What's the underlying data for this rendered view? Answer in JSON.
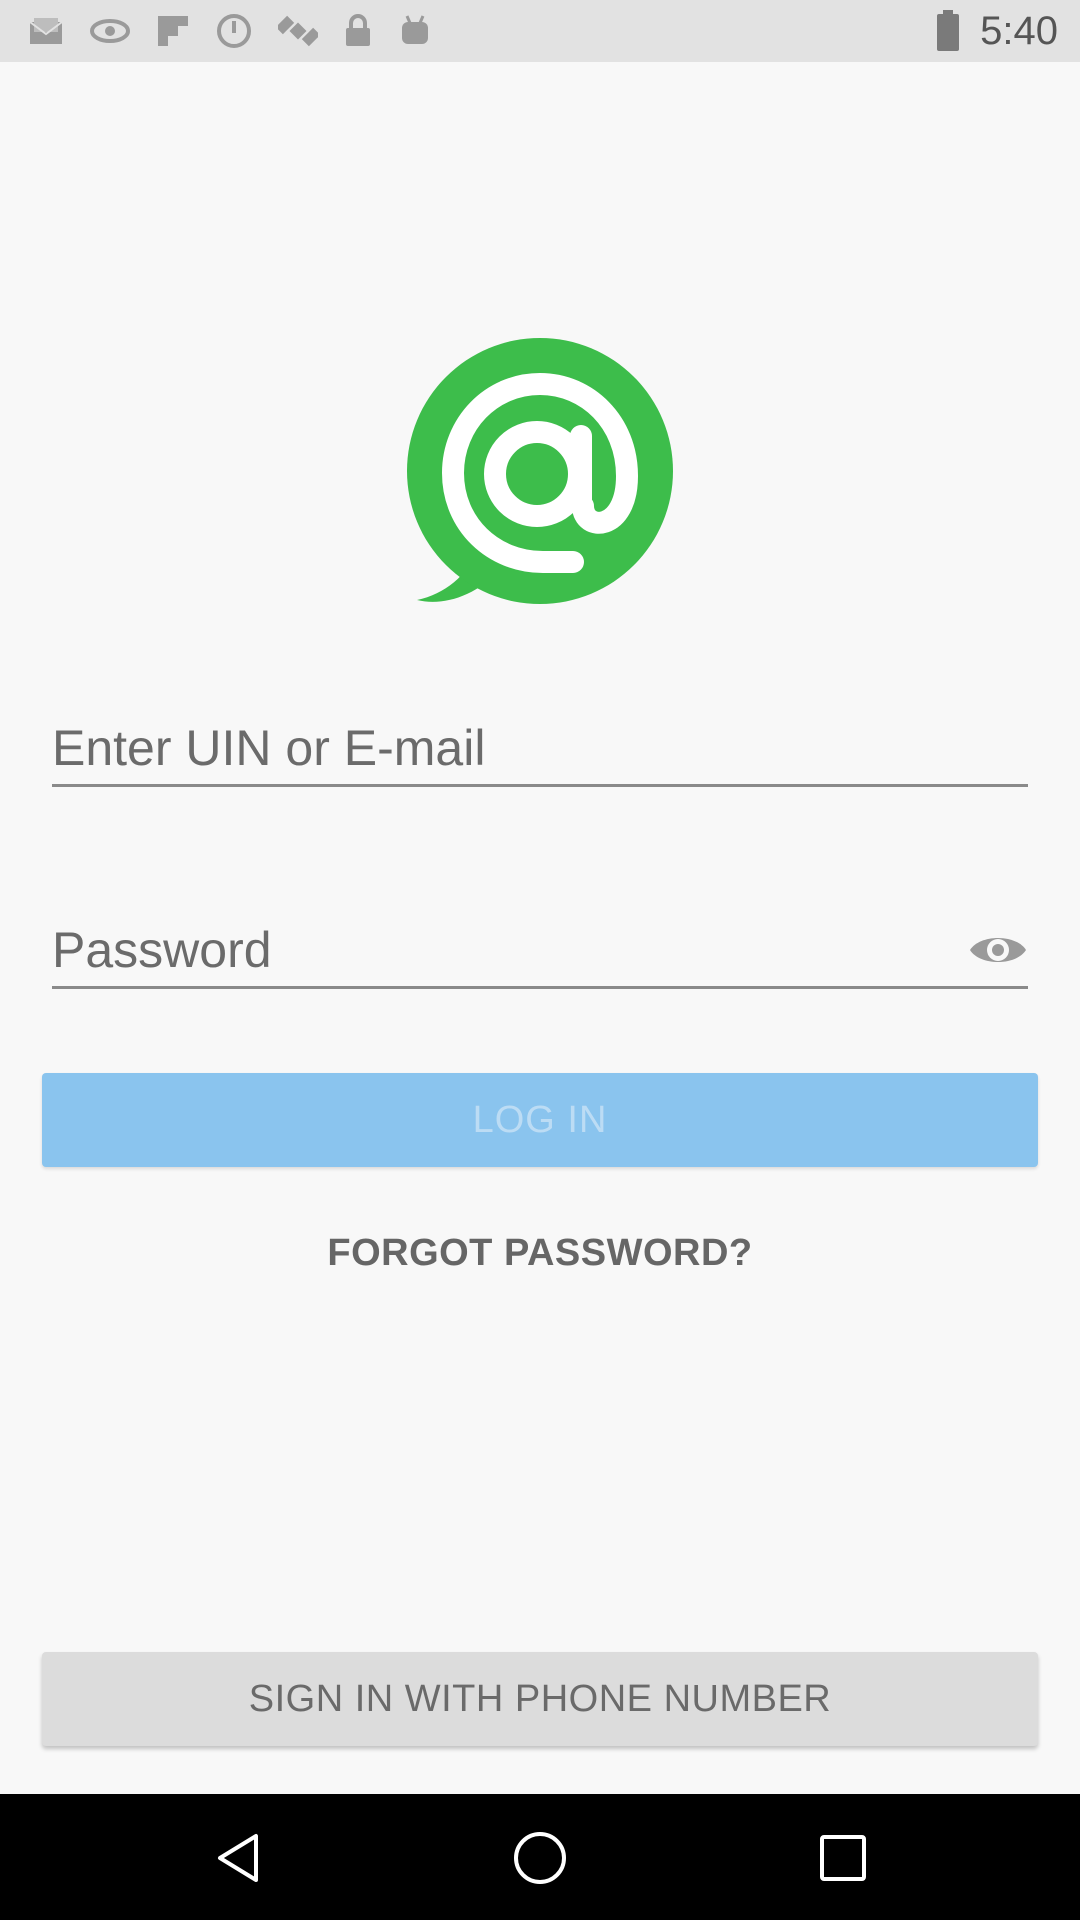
{
  "status_bar": {
    "time": "5:40",
    "left_icons": [
      "email-icon",
      "wifi-icon",
      "flipboard-icon",
      "sync-icon",
      "satellite-icon",
      "lock-icon",
      "android-icon"
    ],
    "right_icons": [
      "battery-icon"
    ]
  },
  "login": {
    "uin_placeholder": "Enter UIN or E-mail",
    "password_placeholder": "Password",
    "login_label": "LOG IN",
    "forgot_label": "FORGOT PASSWORD?",
    "phone_label": "SIGN IN WITH PHONE NUMBER"
  },
  "colors": {
    "logo_green": "#3dbd4b",
    "login_button": "#8ac4ee",
    "phone_button": "#dcdcdc"
  },
  "nav_bar": {
    "icons": [
      "back-icon",
      "home-icon",
      "recents-icon"
    ]
  }
}
